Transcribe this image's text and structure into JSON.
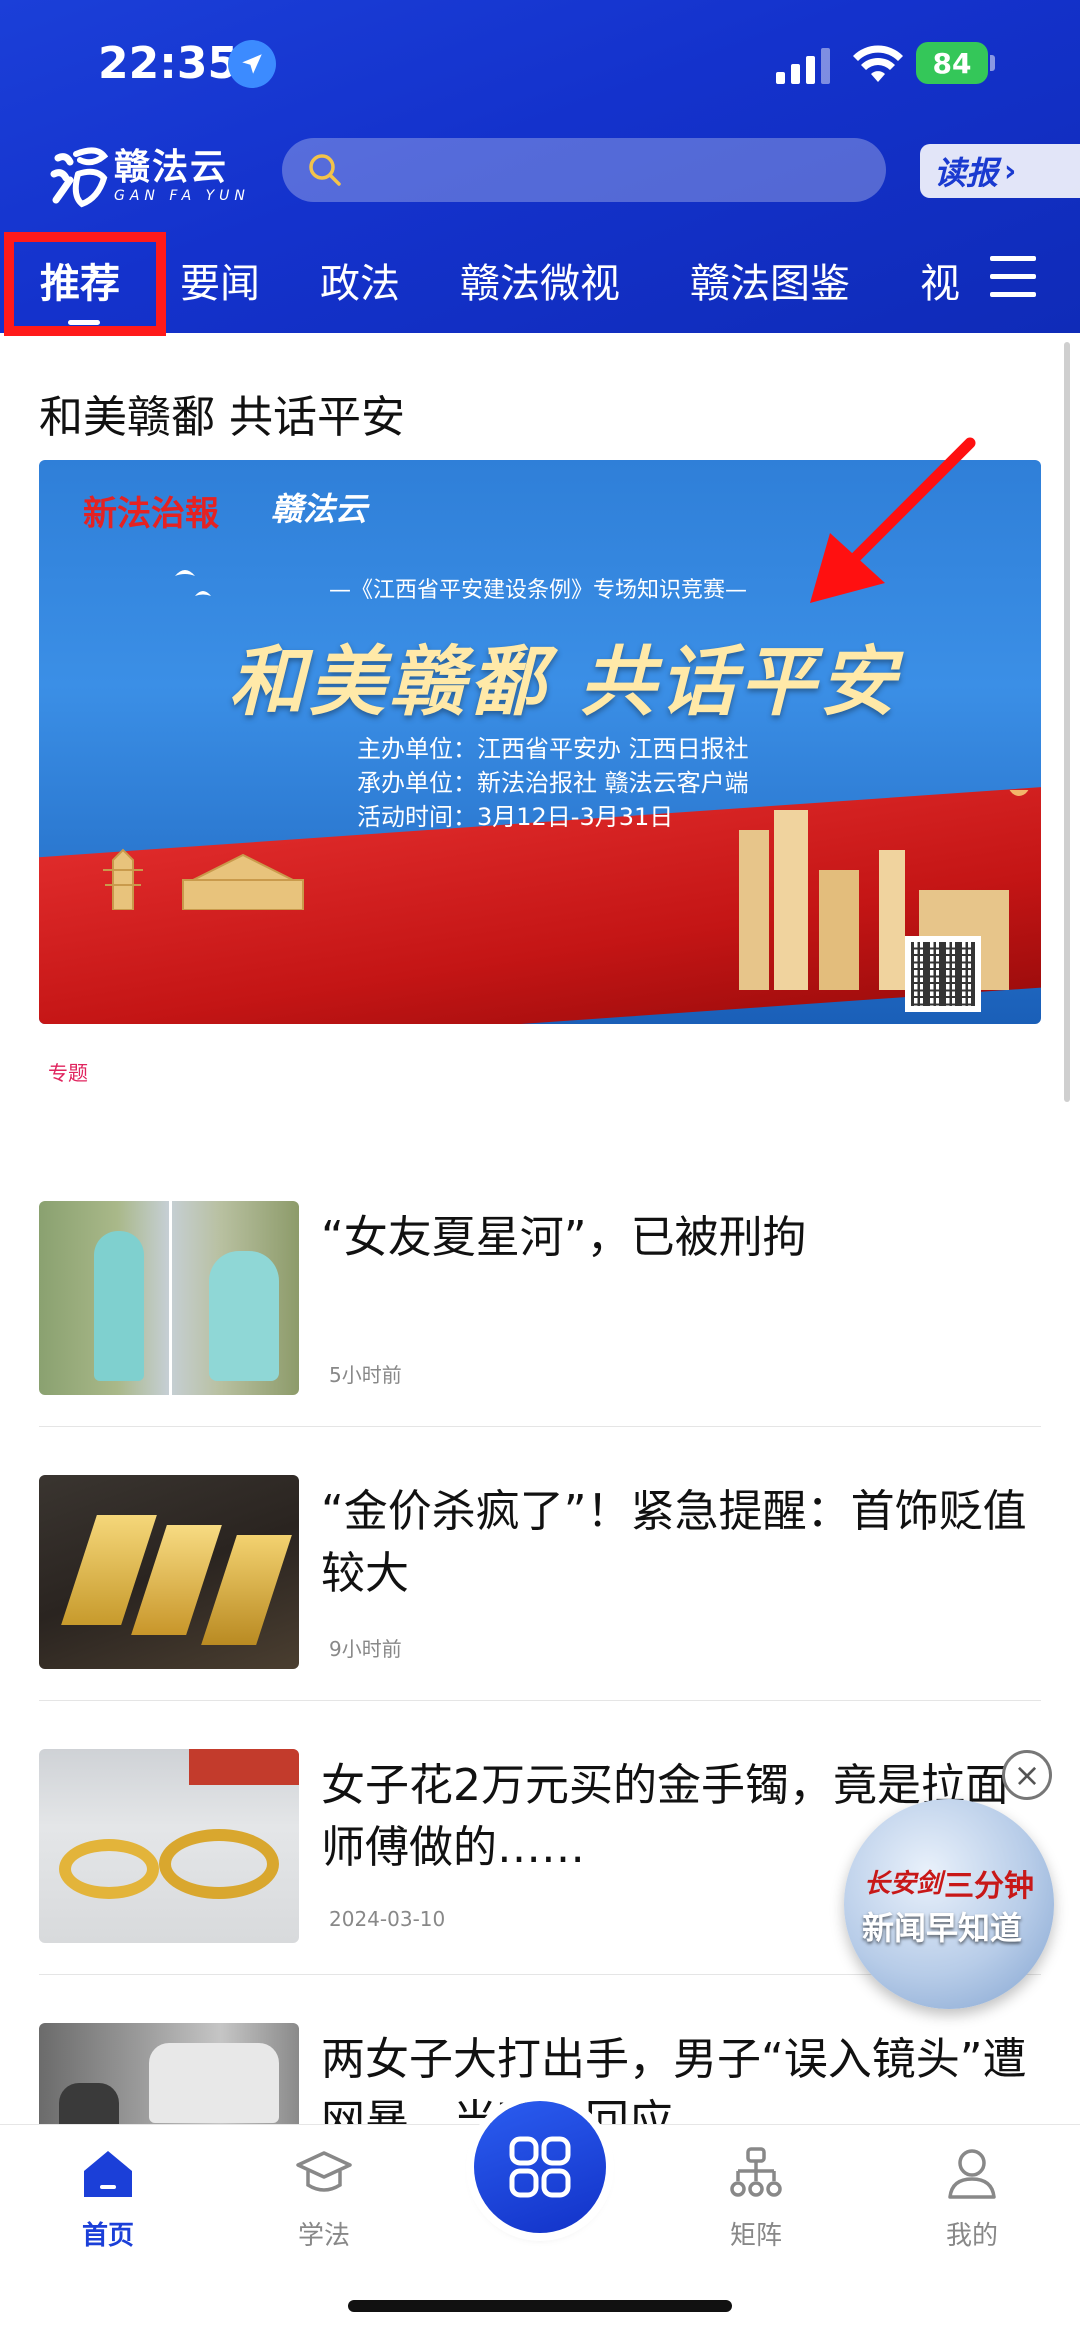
{
  "status_bar": {
    "time": "22:35",
    "battery": "84"
  },
  "header": {
    "logo_cn": "赣法云",
    "logo_en": "GAN FA YUN",
    "search_placeholder": "",
    "read_news_label": "读报"
  },
  "tabs": [
    {
      "label": "推荐",
      "active": true
    },
    {
      "label": "要闻"
    },
    {
      "label": "政法"
    },
    {
      "label": "赣法微视"
    },
    {
      "label": "赣法图鉴"
    },
    {
      "label": "视"
    }
  ],
  "feature": {
    "headline": "和美赣鄱 共话平安",
    "banner": {
      "brand1": "新法治報",
      "brand2": "赣法云",
      "subtitle": "—《江西省平安建设条例》专场知识竞赛—",
      "title": "和美赣鄱  共话平安",
      "info": [
        "主办单位：江西省平安办 江西日报社",
        "承办单位：新法治报社 赣法云客户端",
        "活动时间：3月12日-3月31日"
      ]
    },
    "tag": "专题"
  },
  "news": [
    {
      "title": "“女友夏星河”，已被刑拘",
      "time": "5小时前"
    },
    {
      "title": "“金价杀疯了”！紧急提醒：首饰贬值较大",
      "time": "9小时前"
    },
    {
      "title": "女子花2万元买的金手镯，竟是拉面师傅做的……",
      "time": "2024-03-10"
    },
    {
      "title": "两女子大打出手，男子“误入镜头”遭网暴，当事人回应",
      "time": ""
    }
  ],
  "floating_ad": {
    "line1a": "长安剑",
    "line1b": "三分钟",
    "line2": "新闻早知道"
  },
  "bottom_nav": [
    {
      "label": "首页",
      "active": true
    },
    {
      "label": "学法"
    },
    {
      "label": "矩阵"
    },
    {
      "label": "我的"
    }
  ],
  "colors": {
    "brand_blue": "#1b3fd8",
    "highlight_red": "#ff1a1a",
    "tag_pink": "#e0245e"
  }
}
